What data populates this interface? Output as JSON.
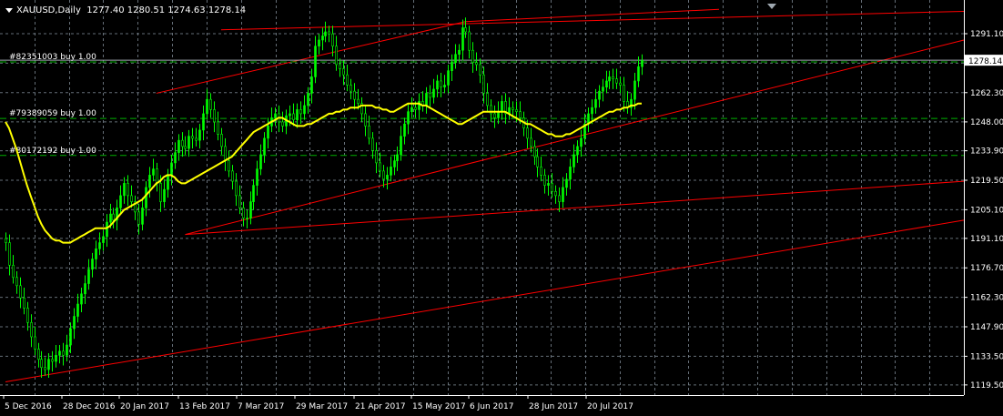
{
  "header": {
    "symbol": "XAUUSD,Daily",
    "ohlc": "1277.40 1280.51 1274.63 1278.14"
  },
  "colors": {
    "background": "#000000",
    "grid": "#7f8a95",
    "axis": "#ffffff",
    "candle": "#00ff00",
    "ma": "#ffff00",
    "trendline": "#ff0000",
    "order_line": "#00b000",
    "price_line": "#9fa8b0",
    "price_label_bg": "#ffffff"
  },
  "chart_data": {
    "type": "candlestick",
    "instrument": "XAUUSD",
    "timeframe": "Daily",
    "y_ticks": [
      1291.1,
      1276.7,
      1262.3,
      1248.0,
      1233.9,
      1219.5,
      1205.1,
      1191.1,
      1176.7,
      1162.3,
      1147.9,
      1133.5,
      1119.5
    ],
    "y_tick_labels": [
      "1291.10",
      "1262.30",
      "1248.00",
      "1233.90",
      "1219.50",
      "1205.10",
      "1191.10",
      "1176.70",
      "1162.30",
      "1147.90",
      "1133.50",
      "1119.50"
    ],
    "ylim": [
      1119.5,
      1303
    ],
    "x_labels": [
      "5 Dec 2016",
      "28 Dec 2016",
      "20 Jan 2017",
      "13 Feb 2017",
      "7 Mar 2017",
      "29 Mar 2017",
      "21 Apr 2017",
      "15 May 2017",
      "6 Jun 2017",
      "28 Jun 2017",
      "20 Jul 2017"
    ],
    "current_price": 1278.14,
    "current_price_label": "1278.14",
    "close_series": [
      1189,
      1178,
      1172,
      1168,
      1162,
      1157,
      1150,
      1143,
      1137,
      1132,
      1128,
      1127,
      1132,
      1131,
      1134,
      1136,
      1134,
      1139,
      1147,
      1153,
      1159,
      1164,
      1169,
      1176,
      1181,
      1186,
      1189,
      1192,
      1199,
      1203,
      1200,
      1206,
      1212,
      1218,
      1212,
      1209,
      1204,
      1198,
      1206,
      1216,
      1222,
      1225,
      1218,
      1209,
      1215,
      1222,
      1228,
      1233,
      1239,
      1236,
      1235,
      1241,
      1240,
      1239,
      1244,
      1252,
      1259,
      1254,
      1248,
      1242,
      1236,
      1229,
      1224,
      1219,
      1212,
      1206,
      1201,
      1201,
      1209,
      1217,
      1225,
      1232,
      1240,
      1246,
      1250,
      1252,
      1248,
      1246,
      1251,
      1252,
      1249,
      1254,
      1252,
      1256,
      1262,
      1270,
      1285,
      1288,
      1290,
      1292,
      1291,
      1285,
      1276,
      1274,
      1271,
      1266,
      1263,
      1259,
      1257,
      1252,
      1246,
      1240,
      1234,
      1228,
      1224,
      1220,
      1222,
      1226,
      1229,
      1232,
      1241,
      1247,
      1253,
      1255,
      1254,
      1258,
      1256,
      1262,
      1260,
      1264,
      1268,
      1265,
      1266,
      1273,
      1277,
      1281,
      1283,
      1294,
      1292,
      1283,
      1277,
      1276,
      1271,
      1262,
      1256,
      1252,
      1250,
      1253,
      1258,
      1252,
      1255,
      1254,
      1253,
      1250,
      1245,
      1240,
      1236,
      1231,
      1226,
      1222,
      1217,
      1218,
      1214,
      1212,
      1209,
      1216,
      1220,
      1226,
      1232,
      1236,
      1240,
      1247,
      1252,
      1255,
      1259,
      1263,
      1265,
      1268,
      1270,
      1269,
      1267,
      1266,
      1258,
      1255,
      1259,
      1268,
      1275,
      1278
    ],
    "moving_average": {
      "name": "MA",
      "values": [
        1248,
        1245,
        1240,
        1235,
        1229,
        1223,
        1217,
        1212,
        1207,
        1202,
        1198,
        1195,
        1193,
        1191,
        1190,
        1190,
        1189,
        1189,
        1189,
        1190,
        1191,
        1192,
        1193,
        1194,
        1195,
        1196,
        1196,
        1196,
        1196,
        1197,
        1199,
        1201,
        1203,
        1205,
        1206,
        1207,
        1208,
        1209,
        1210,
        1212,
        1214,
        1216,
        1218,
        1219,
        1221,
        1222,
        1222,
        1221,
        1219,
        1218,
        1218,
        1219,
        1220,
        1221,
        1222,
        1223,
        1224,
        1225,
        1226,
        1227,
        1228,
        1229,
        1230,
        1231,
        1233,
        1235,
        1237,
        1239,
        1241,
        1243,
        1244,
        1245,
        1246,
        1247,
        1248,
        1249,
        1250,
        1250,
        1249,
        1248,
        1247,
        1246,
        1246,
        1246,
        1247,
        1247,
        1248,
        1249,
        1250,
        1251,
        1252,
        1252,
        1253,
        1253,
        1254,
        1254,
        1255,
        1255,
        1255,
        1256,
        1256,
        1256,
        1256,
        1255,
        1255,
        1254,
        1254,
        1253,
        1253,
        1254,
        1255,
        1256,
        1257,
        1257,
        1257,
        1257,
        1256,
        1256,
        1255,
        1254,
        1253,
        1252,
        1251,
        1250,
        1249,
        1248,
        1247,
        1247,
        1248,
        1249,
        1250,
        1251,
        1252,
        1253,
        1253,
        1253,
        1253,
        1253,
        1253,
        1253,
        1252,
        1251,
        1250,
        1249,
        1248,
        1247,
        1247,
        1246,
        1245,
        1244,
        1243,
        1242,
        1242,
        1241,
        1241,
        1241,
        1242,
        1242,
        1243,
        1244,
        1245,
        1246,
        1247,
        1248,
        1249,
        1250,
        1251,
        1252,
        1253,
        1253,
        1254,
        1254,
        1255,
        1255,
        1256,
        1256,
        1257,
        1257
      ]
    },
    "order_lines": [
      {
        "label": "#82351003 buy 1.00",
        "price": 1277.3
      },
      {
        "label": "#79389059 buy 1.00",
        "price": 1249.7
      },
      {
        "label": "#80172192 buy 1.00",
        "price": 1231.6
      }
    ]
  }
}
